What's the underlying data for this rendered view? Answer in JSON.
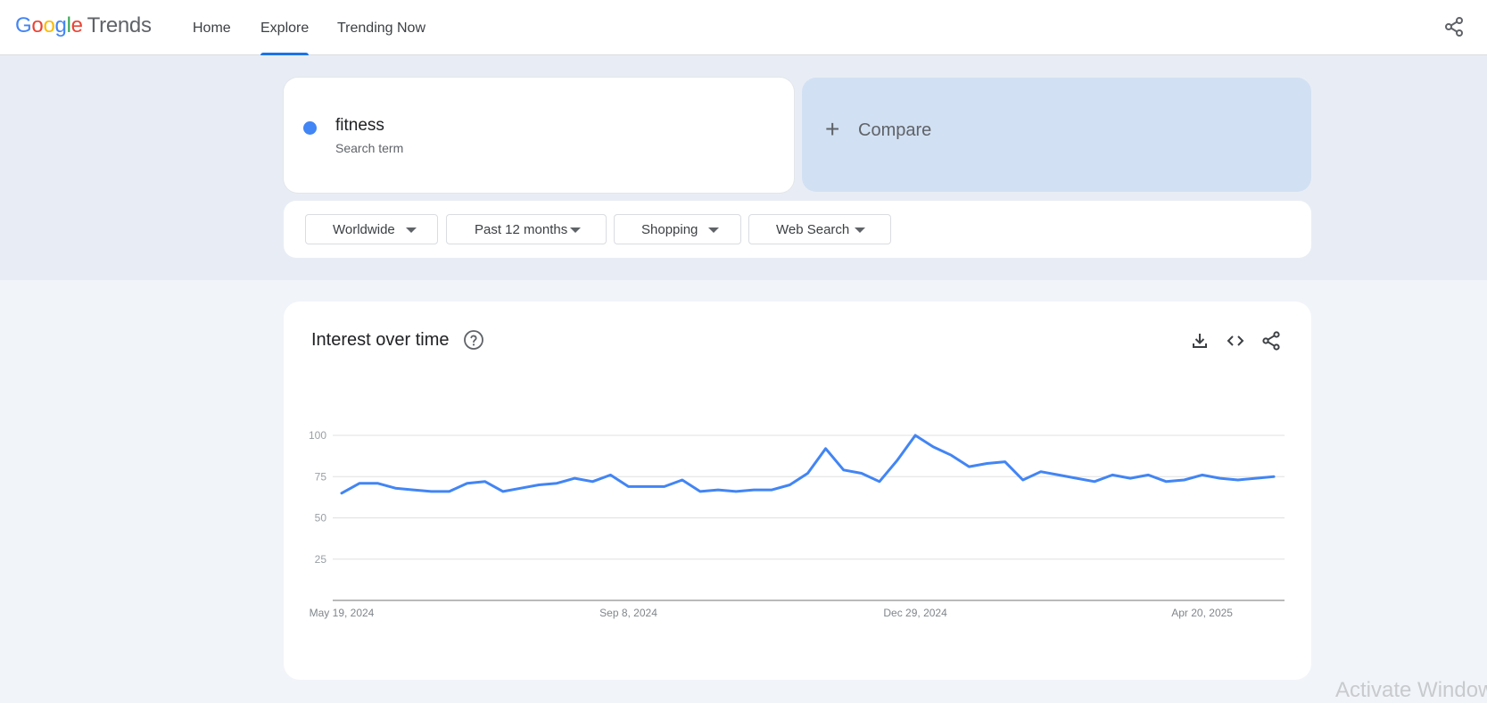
{
  "header": {
    "logo_text": "Google Trends",
    "nav": [
      {
        "label": "Home"
      },
      {
        "label": "Explore",
        "active": true
      },
      {
        "label": "Trending Now"
      }
    ],
    "share_icon": "share-icon"
  },
  "search": {
    "term": "fitness",
    "term_subtitle": "Search term",
    "term_color": "#4285f4",
    "compare_label": "Compare"
  },
  "filters": {
    "region": "Worldwide",
    "time_range": "Past 12 months",
    "category": "Shopping",
    "search_type": "Web Search"
  },
  "interest_card": {
    "title": "Interest over time",
    "help_icon": "help-circle-icon",
    "actions": [
      "download-icon",
      "embed-code-icon",
      "share-icon"
    ]
  },
  "chart_data": {
    "type": "line",
    "ylim": [
      0,
      100
    ],
    "yticks": [
      25,
      50,
      75,
      100
    ],
    "x_tick_labels": [
      "May 19, 2024",
      "Sep 8, 2024",
      "Dec 29, 2024",
      "Apr 20, 2025"
    ],
    "x_tick_indices": [
      0,
      16,
      32,
      48
    ],
    "grid": true,
    "series": [
      {
        "color": "#4285f4",
        "values": [
          65,
          71,
          71,
          68,
          67,
          66,
          66,
          71,
          72,
          66,
          68,
          70,
          71,
          74,
          72,
          76,
          69,
          69,
          69,
          73,
          66,
          67,
          66,
          67,
          67,
          70,
          77,
          92,
          79,
          77,
          72,
          85,
          100,
          93,
          88,
          81,
          83,
          84,
          73,
          78,
          76,
          74,
          72,
          76,
          74,
          76,
          72,
          73,
          76,
          74,
          73,
          74,
          75
        ]
      }
    ]
  },
  "watermark": "Activate Windows"
}
